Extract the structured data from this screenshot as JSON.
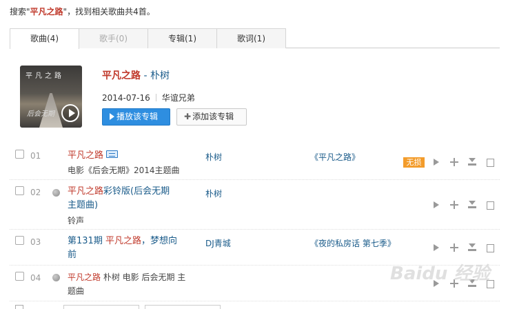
{
  "search_summary": {
    "prefix": "搜索\"",
    "keyword": "平凡之路",
    "suffix": "\"，找到相关歌曲共4首。"
  },
  "tabs": [
    {
      "label": "歌曲(4)",
      "state": "active"
    },
    {
      "label": "歌手(0)",
      "state": "disabled"
    },
    {
      "label": "专辑(1)",
      "state": "normal"
    },
    {
      "label": "歌词(1)",
      "state": "normal"
    }
  ],
  "album": {
    "cover_title": "平凡之路",
    "cover_subtitle": "后会无期",
    "name": "平凡之路",
    "separator": " - ",
    "artist": "朴树",
    "date": "2014-07-16",
    "company": "华谊兄弟",
    "play_button": "播放该专辑",
    "add_button": "添加该专辑"
  },
  "songs": [
    {
      "index": "01",
      "has_mv": true,
      "title_hl": "平凡之路",
      "title_rest": "",
      "title_line2": "",
      "desc_line1": "电影《后会无期》2014主题曲",
      "desc_line2": "",
      "artist": "朴树",
      "album": "《平凡之路》",
      "badge": "无损"
    },
    {
      "index": "02",
      "has_globe": true,
      "title_hl": "平凡之路",
      "title_rest": "彩铃版(后会无期",
      "title_line2": "主题曲)",
      "desc_line1": "铃声",
      "artist": "朴树",
      "album": "",
      "badge": ""
    },
    {
      "index": "03",
      "title_pre": "第131期 ",
      "title_hl": "平凡之路",
      "title_rest": "，梦想向",
      "title_line2": "前",
      "artist": "DJ青城",
      "album": "《夜的私房话 第七季》",
      "badge": ""
    },
    {
      "index": "04",
      "has_globe": true,
      "title_hl": "平凡之路",
      "title_rest": " 朴树 电影 后会无期 主",
      "title_line2": "题曲",
      "artist": "",
      "album": "",
      "badge": ""
    }
  ],
  "watermark": "Baidu 经验",
  "icons": {
    "play": "play-icon",
    "add": "plus-icon",
    "download": "download-icon",
    "more": "box-icon"
  },
  "colors": {
    "accent_red": "#c0392b",
    "link_blue": "#1a5b8a",
    "button_blue": "#2e8ee0",
    "badge_orange": "#f39c2b"
  }
}
